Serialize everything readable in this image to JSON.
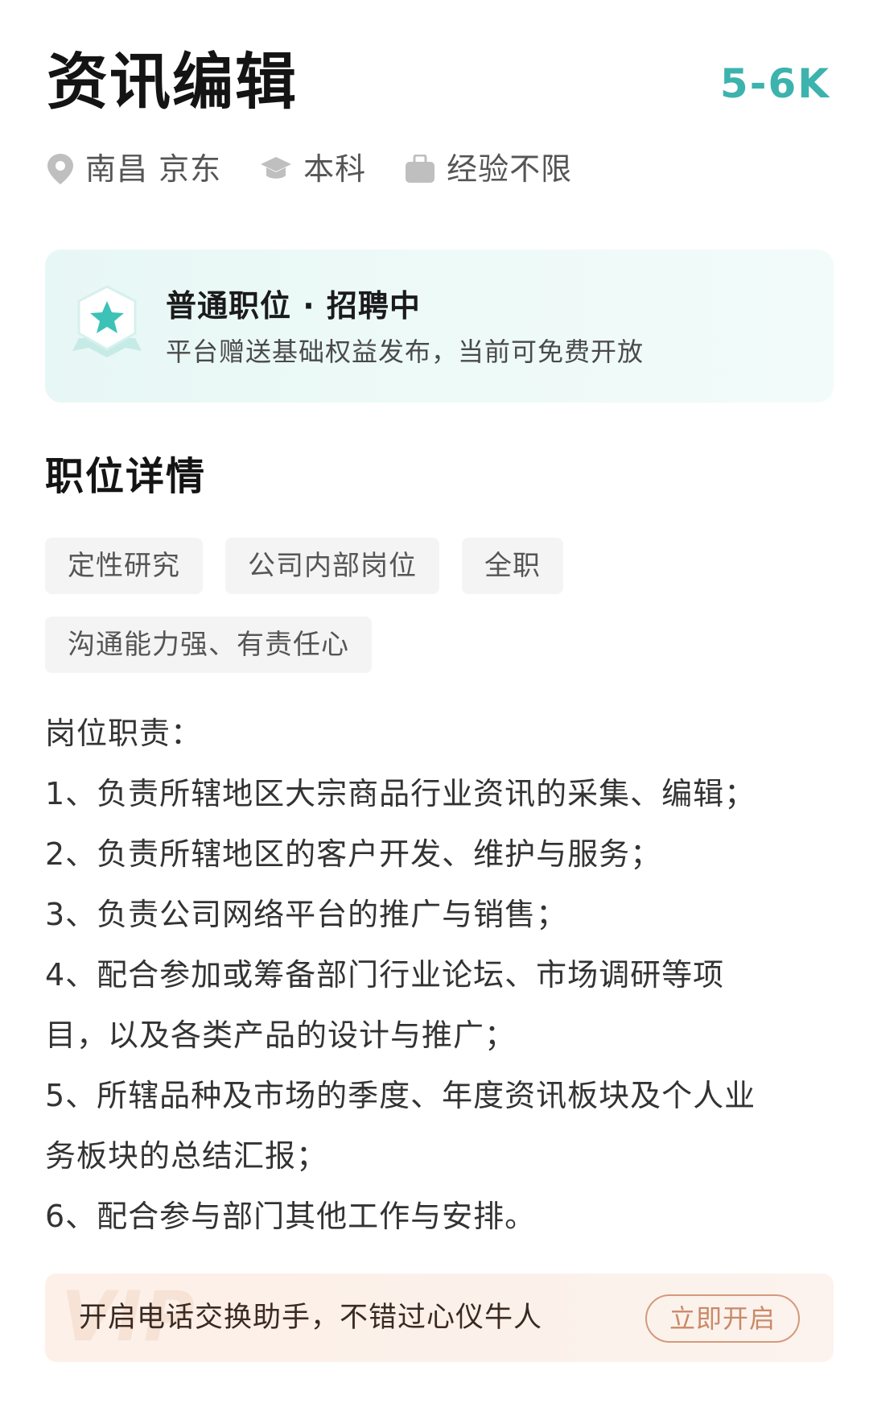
{
  "job": {
    "title": "资讯编辑",
    "salary": "5-6K"
  },
  "meta": {
    "location": "南昌 京东",
    "education": "本科",
    "experience": "经验不限",
    "icons": [
      "location-pin-icon",
      "graduation-cap-icon",
      "briefcase-icon"
    ]
  },
  "status_card": {
    "title": "普通职位 · 招聘中",
    "description": "平台赠送基础权益发布，当前可免费开放",
    "accent_color": "#3cc2b6"
  },
  "details": {
    "title": "职位详情",
    "tags": [
      "定性研究",
      "公司内部岗位",
      "全职",
      "沟通能力强、有责任心"
    ],
    "description_lines": [
      "岗位职责：",
      "1、负责所辖地区大宗商品行业资讯的采集、编辑；",
      "2、负责所辖地区的客户开发、维护与服务；",
      "3、负责公司网络平台的推广与销售；",
      "4、配合参加或筹备部门行业论坛、市场调研等项",
      "目，以及各类产品的设计与推广；",
      "5、所辖品种及市场的季度、年度资讯板块及个人业",
      "务板块的总结汇报；",
      "6、配合参与部门其他工作与安排。"
    ]
  },
  "promo": {
    "watermark": "VIP",
    "text": "开启电话交换助手，不错过心仪牛人",
    "button_label": "立即开启"
  },
  "colors": {
    "salary": "#3cb3ad",
    "promo_button": "#c98a68"
  }
}
